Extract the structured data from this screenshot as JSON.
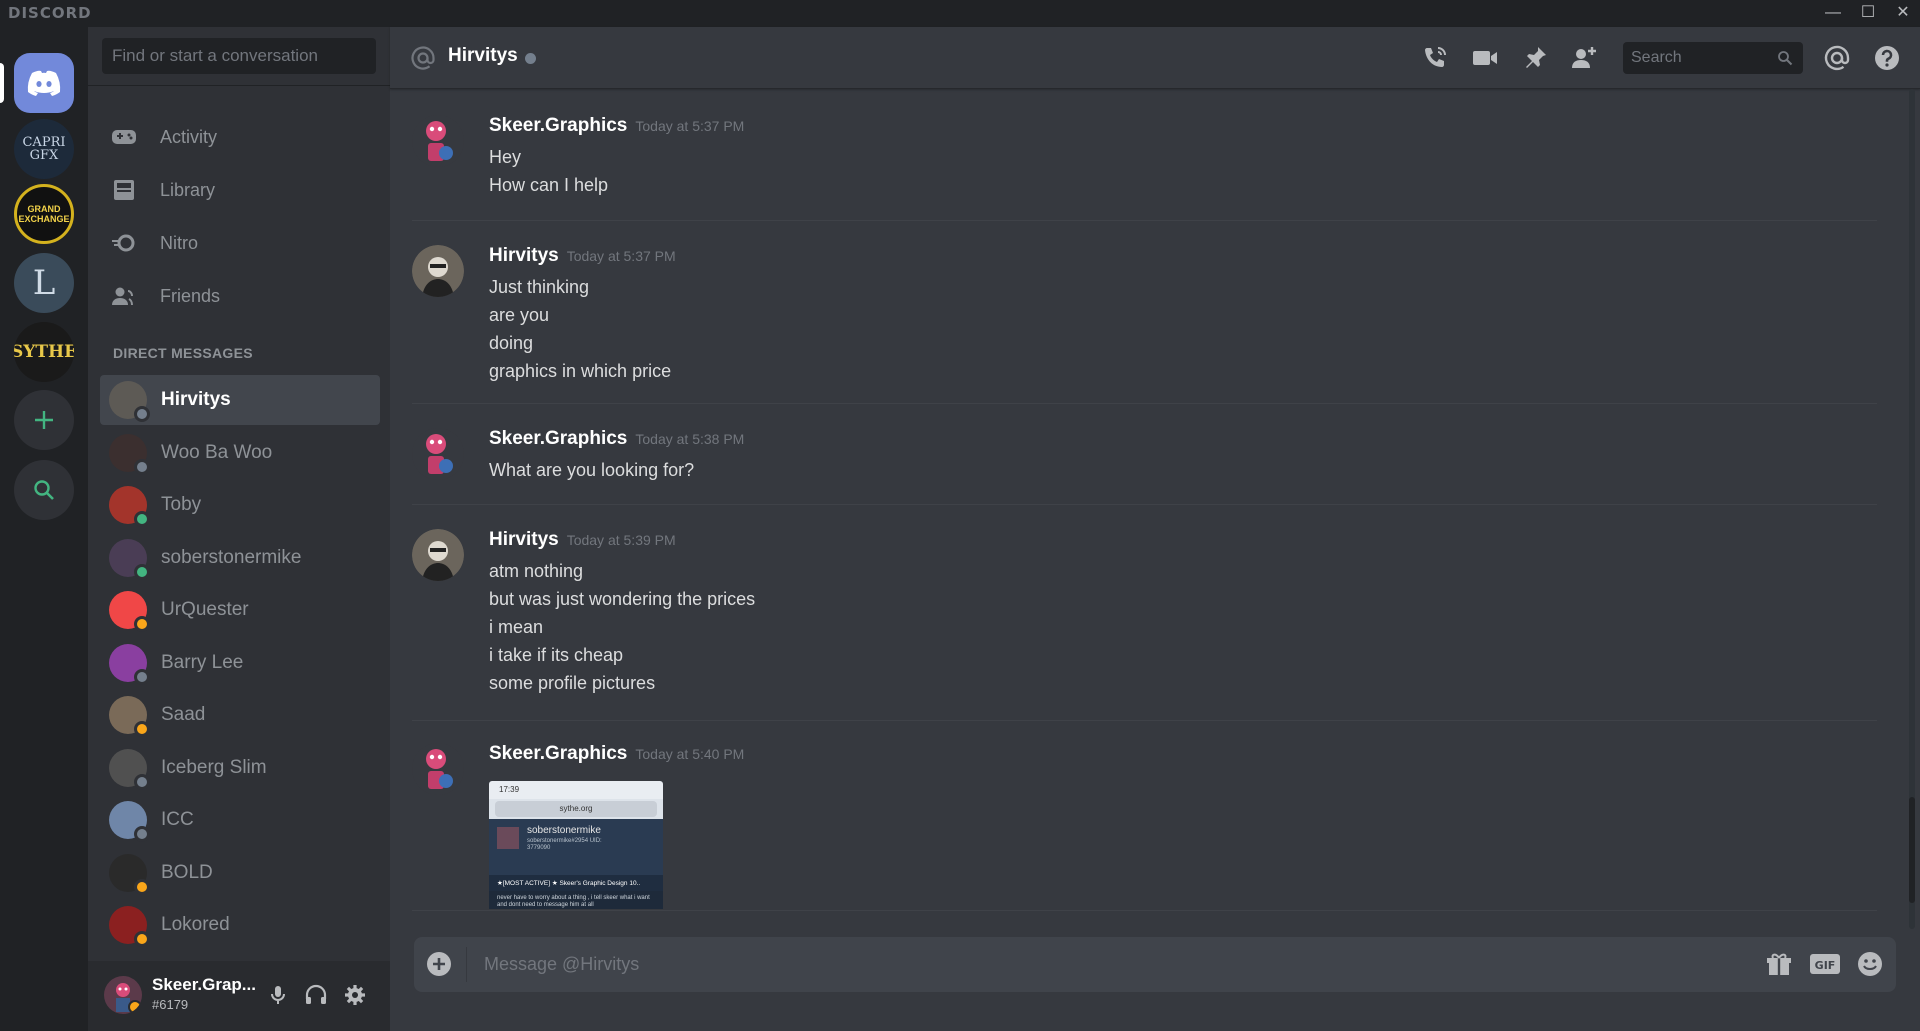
{
  "app": {
    "brand": "DISCORD",
    "window_controls": {
      "minimize": "—",
      "maximize": "☐",
      "close": "✕"
    }
  },
  "servers": [
    {
      "name": "CAPRI GFX",
      "label": "CAPRI\nGFX"
    },
    {
      "name": "Grand Exchange",
      "label": "GRAND\nEXCHANGE"
    },
    {
      "name": "L server",
      "label": "L"
    },
    {
      "name": "Sythe",
      "label": "SYTHE"
    }
  ],
  "sidebar": {
    "search_placeholder": "Find or start a conversation",
    "nav": [
      {
        "label": "Activity",
        "icon": "gamepad-icon"
      },
      {
        "label": "Library",
        "icon": "library-icon"
      },
      {
        "label": "Nitro",
        "icon": "nitro-icon"
      },
      {
        "label": "Friends",
        "icon": "friends-icon"
      }
    ],
    "dm_header": "DIRECT MESSAGES",
    "dms": [
      {
        "name": "Hirvitys",
        "status_color": "#747f8d",
        "avatar_color": "#5d5a55",
        "active": true
      },
      {
        "name": "Woo Ba Woo",
        "status_color": "#747f8d",
        "avatar_color": "#3b2f2f"
      },
      {
        "name": "Toby",
        "status_color": "#43b581",
        "avatar_color": "#a3342b"
      },
      {
        "name": "soberstonermike",
        "status_color": "#43b581",
        "avatar_color": "#4a3d55"
      },
      {
        "name": "UrQuester",
        "status_color": "#faa61a",
        "avatar_color": "#f04747"
      },
      {
        "name": "Barry Lee",
        "status_color": "#747f8d",
        "avatar_color": "#8a3fa0"
      },
      {
        "name": "Saad",
        "status_color": "#faa61a",
        "avatar_color": "#7a6a58"
      },
      {
        "name": "Iceberg Slim",
        "status_color": "#747f8d",
        "avatar_color": "#505050"
      },
      {
        "name": "ICC",
        "status_color": "#747f8d",
        "avatar_color": "#6f86a8"
      },
      {
        "name": "BOLD",
        "status_color": "#faa61a",
        "avatar_color": "#2a2a2a"
      },
      {
        "name": "Lokored",
        "status_color": "#faa61a",
        "avatar_color": "#8b2020"
      }
    ],
    "user": {
      "name": "Skeer.Grap...",
      "tag": "#6179"
    }
  },
  "chat": {
    "recipient": "Hirvitys",
    "search_placeholder": "Search",
    "composer_placeholder": "Message @Hirvitys",
    "messages": [
      {
        "author": "Skeer.Graphics",
        "time": "Today at 5:37 PM",
        "lines": [
          "Hey",
          "How can I help"
        ],
        "avatar": "skeer"
      },
      {
        "author": "Hirvitys",
        "time": "Today at 5:37 PM",
        "lines": [
          "Just thinking",
          "are you",
          "doing",
          "graphics in which price"
        ],
        "avatar": "hirvitys"
      },
      {
        "author": "Skeer.Graphics",
        "time": "Today at 5:38 PM",
        "lines": [
          "What are you looking for?"
        ],
        "avatar": "skeer"
      },
      {
        "author": "Hirvitys",
        "time": "Today at 5:39 PM",
        "lines": [
          "atm nothing",
          "but was just wondering the prices",
          "i mean",
          "i take if its cheap",
          "some profile pictures"
        ],
        "avatar": "hirvitys"
      },
      {
        "author": "Skeer.Graphics",
        "time": "Today at 5:40 PM",
        "lines": [],
        "avatar": "skeer"
      }
    ],
    "attachment": {
      "time": "17:39",
      "url": "sythe.org",
      "profile_name": "soberstonermike",
      "profile_sub": "soberstonermike#2954 UID: 3779090",
      "thread": "★[MOST ACTIVE] ★ Skeer's Graphic Design 10..",
      "snippet": "never have to worry about a thing , i tell skeer what i want and dont need to message him at all"
    }
  }
}
